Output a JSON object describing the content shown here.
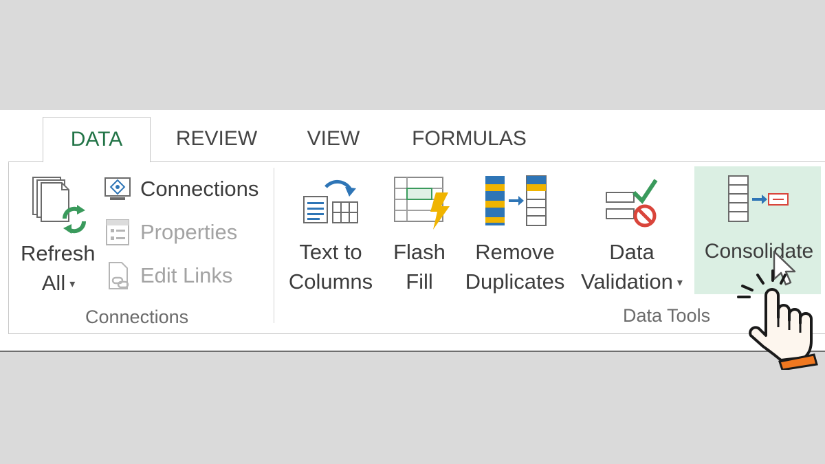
{
  "tabs": [
    {
      "label": "DATA",
      "active": true
    },
    {
      "label": "REVIEW",
      "active": false
    },
    {
      "label": "VIEW",
      "active": false
    },
    {
      "label": "FORMULAS",
      "active": false
    }
  ],
  "connections_group": {
    "refresh_all": {
      "line1": "Refresh",
      "line2": "All"
    },
    "connections": "Connections",
    "properties": "Properties",
    "edit_links": "Edit Links",
    "group_label": "Connections"
  },
  "data_tools_group": {
    "text_to_columns": {
      "line1": "Text to",
      "line2": "Columns"
    },
    "flash_fill": {
      "line1": "Flash",
      "line2": "Fill"
    },
    "remove_duplicates": {
      "line1": "Remove",
      "line2": "Duplicates"
    },
    "data_validation": {
      "line1": "Data",
      "line2": "Validation"
    },
    "consolidate": "Consolidate",
    "group_label": "Data Tools"
  },
  "colors": {
    "active_tab": "#217346",
    "highlight": "#dbefe3",
    "icon_blue": "#2e75b6",
    "icon_gold": "#f0b400",
    "icon_green": "#3a9a5c",
    "icon_red": "#d9453b",
    "hand_orange": "#f07820"
  },
  "icons": [
    "refresh-all-icon",
    "connections-icon",
    "properties-icon",
    "edit-links-icon",
    "text-to-columns-icon",
    "flash-fill-icon",
    "remove-duplicates-icon",
    "data-validation-icon",
    "consolidate-icon",
    "mouse-cursor-icon",
    "pointing-hand-icon"
  ]
}
